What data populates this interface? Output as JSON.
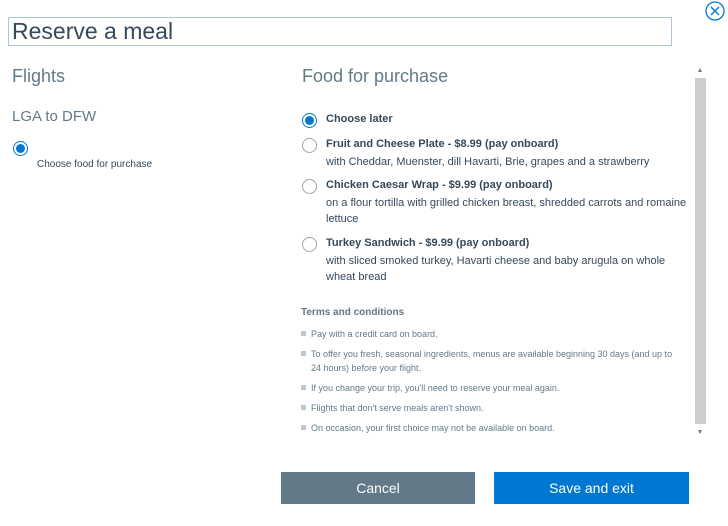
{
  "dialog": {
    "title": "Reserve a meal",
    "close_icon": "close-circle-icon"
  },
  "left": {
    "heading": "Flights",
    "route": "LGA to DFW",
    "choose_label": "Choose food for purchase"
  },
  "right": {
    "heading": "Food for purchase",
    "options": [
      {
        "title": "Choose later",
        "desc": "",
        "selected": true
      },
      {
        "title": "Fruit and Cheese Plate - $8.99 (pay onboard)",
        "desc": "with Cheddar, Muenster, dill Havarti, Brie, grapes and a strawberry",
        "selected": false
      },
      {
        "title": "Chicken Caesar Wrap - $9.99 (pay onboard)",
        "desc": "on a flour tortilla with grilled chicken breast, shredded carrots and romaine lettuce",
        "selected": false
      },
      {
        "title": "Turkey Sandwich - $9.99 (pay onboard)",
        "desc": "with sliced smoked turkey, Havarti cheese and baby arugula on whole wheat bread",
        "selected": false
      }
    ],
    "terms": {
      "heading": "Terms and conditions",
      "items": [
        "Pay with a credit card on board.",
        "To offer you fresh, seasonal ingredients, menus are available beginning 30 days (and up to 24 hours) before your flight.",
        "If you change your trip, you'll need to reserve your meal again.",
        "Flights that don't serve meals aren't shown.",
        "On occasion, your first choice may not be available on board."
      ]
    }
  },
  "buttons": {
    "cancel": "Cancel",
    "save": "Save and exit"
  },
  "colors": {
    "accent": "#0078d2",
    "secondary_button": "#627a88",
    "text": "#36495a"
  }
}
